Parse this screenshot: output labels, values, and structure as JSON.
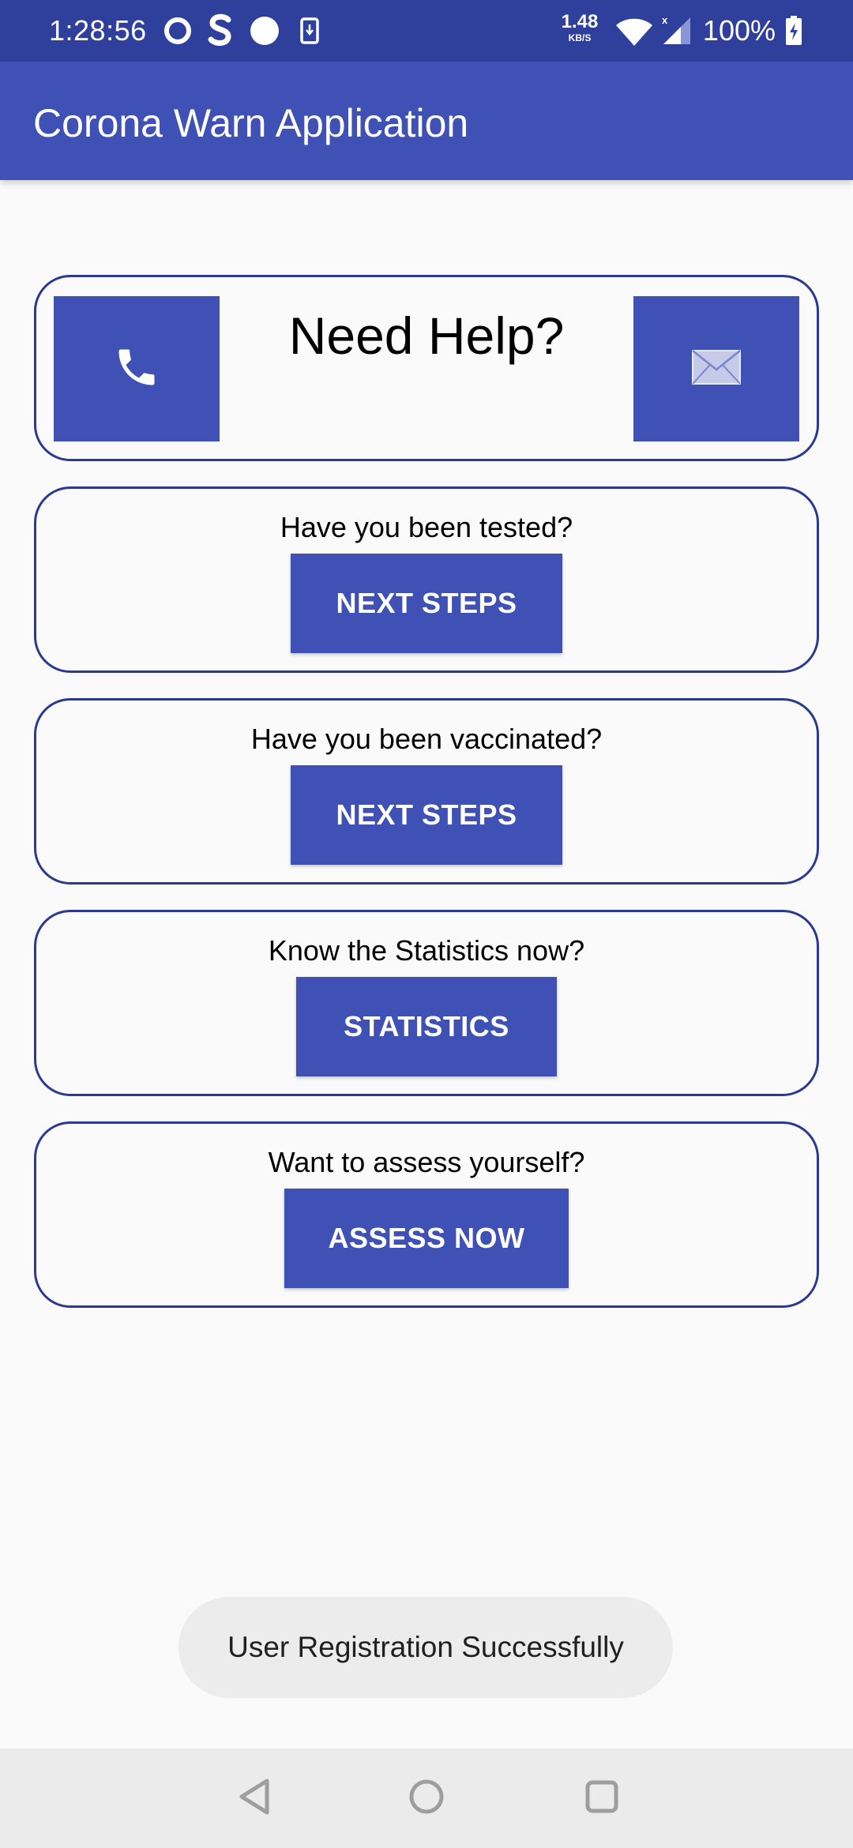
{
  "status_bar": {
    "time": "1:28:56",
    "net_speed_value": "1.48",
    "net_speed_unit": "KB/S",
    "battery_percent": "100%"
  },
  "app_bar": {
    "title": "Corona Warn Application"
  },
  "help_card": {
    "title": "Need Help?",
    "phone_icon": "phone-icon",
    "email_icon": "email-icon"
  },
  "cards": [
    {
      "question": "Have you been tested?",
      "button_label": "NEXT STEPS"
    },
    {
      "question": "Have you been vaccinated?",
      "button_label": "NEXT STEPS"
    },
    {
      "question": "Know the Statistics now?",
      "button_label": "STATISTICS"
    },
    {
      "question": "Want to assess yourself?",
      "button_label": "ASSESS NOW"
    }
  ],
  "toast": {
    "message": "User Registration Successfully"
  },
  "colors": {
    "primary": "#3f51b5",
    "primary_dark": "#2f3f9c",
    "card_border": "#2b3990"
  }
}
